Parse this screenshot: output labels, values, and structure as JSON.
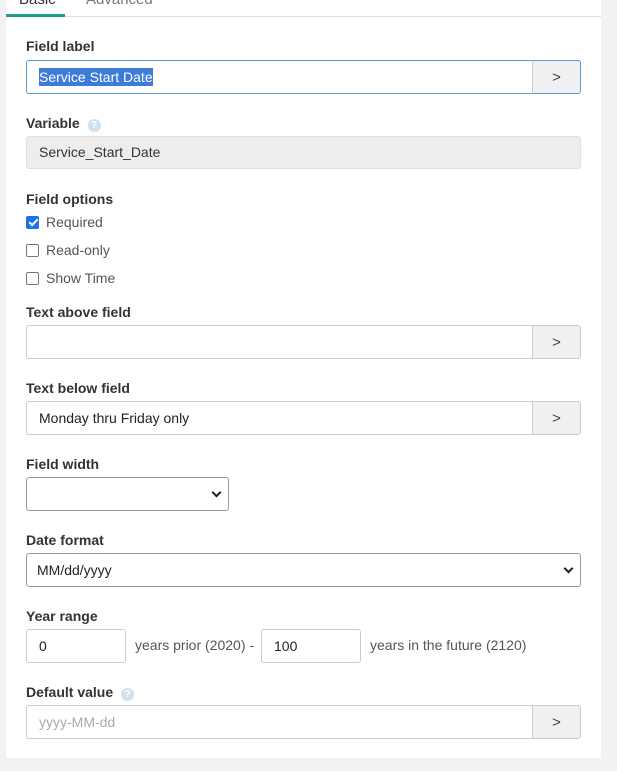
{
  "tabs": {
    "basic": "Basic",
    "advanced": "Advanced"
  },
  "field_label": {
    "label": "Field label",
    "value": "Service Start Date"
  },
  "variable": {
    "label": "Variable",
    "value": "Service_Start_Date"
  },
  "field_options": {
    "label": "Field options",
    "items": [
      {
        "label": "Required",
        "checked": true
      },
      {
        "label": "Read-only",
        "checked": false
      },
      {
        "label": "Show Time",
        "checked": false
      }
    ]
  },
  "text_above": {
    "label": "Text above field",
    "value": ""
  },
  "text_below": {
    "label": "Text below field",
    "value": "Monday thru Friday only"
  },
  "field_width": {
    "label": "Field width",
    "value": ""
  },
  "date_format": {
    "label": "Date format",
    "value": "MM/dd/yyyy"
  },
  "year_range": {
    "label": "Year range",
    "prior_value": "0",
    "prior_text": "years prior (2020) -",
    "future_value": "100",
    "future_text": "years in the future (2120)"
  },
  "default_value": {
    "label": "Default value",
    "placeholder": "yyyy-MM-dd",
    "value": ""
  },
  "arrow_glyph": ">",
  "help_glyph": "?",
  "colors": {
    "accent": "#1f9c8a",
    "selection": "#3d7bd8",
    "checkbox": "#1a73e8"
  }
}
